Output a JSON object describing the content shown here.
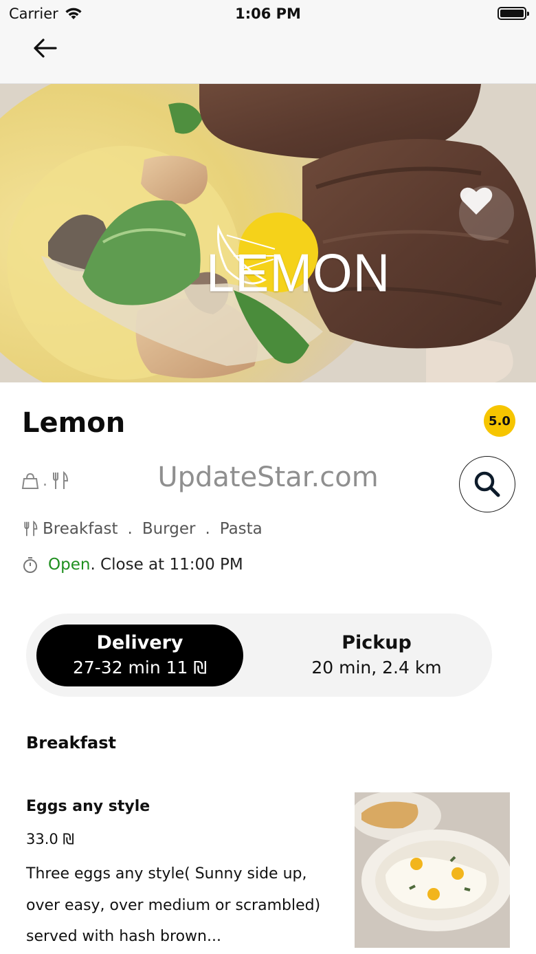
{
  "status_bar": {
    "carrier": "Carrier",
    "time": "1:06 PM"
  },
  "nav": {
    "back_icon": "arrow-left-icon"
  },
  "hero": {
    "logo_text": "LEMON",
    "favorite_icon": "heart-icon"
  },
  "restaurant": {
    "name": "Lemon",
    "rating": "5.0",
    "meta_separator": ".",
    "cuisines": [
      "Breakfast",
      "Burger",
      "Pasta"
    ],
    "cuisine_separator": ".",
    "status": "Open",
    "hours": ". Close at 11:00 PM"
  },
  "watermark": "UpdateStar.com",
  "search": {
    "icon": "search-icon"
  },
  "order_mode": {
    "delivery": {
      "label": "Delivery",
      "detail": "27-32 min 11 ₪",
      "selected": true
    },
    "pickup": {
      "label": "Pickup",
      "detail": "20 min, 2.4 km",
      "selected": false
    }
  },
  "menu": {
    "section_title": "Breakfast",
    "items": [
      {
        "name": "Eggs any style",
        "price": "33.0 ₪",
        "description": "Three eggs any style( Sunny side up, over easy, over medium or scrambled) served with hash brown..."
      }
    ]
  },
  "colors": {
    "rating_badge": "#f6c500",
    "open_status": "#1f8f1f",
    "selected_pill": "#000000",
    "toggle_bg": "#f3f3f3"
  }
}
